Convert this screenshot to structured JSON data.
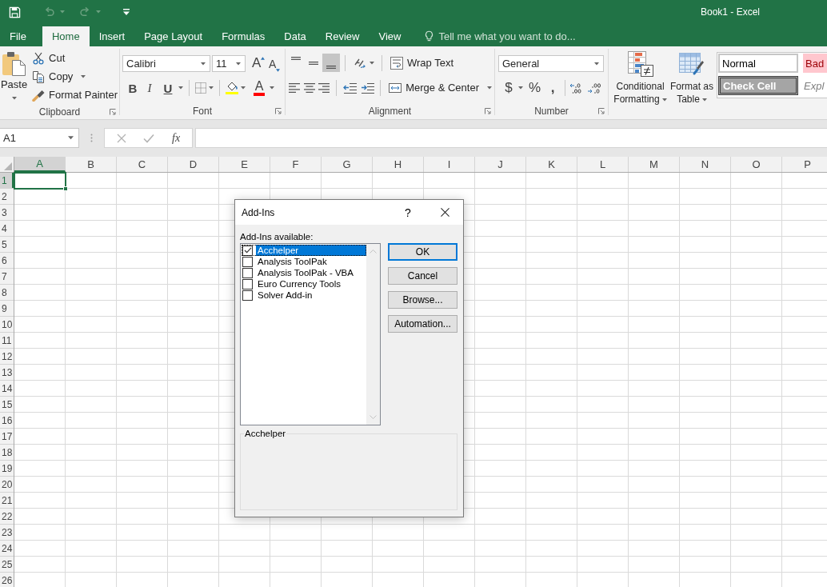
{
  "window": {
    "title": "Book1 - Excel"
  },
  "quick_access": [
    {
      "kind": "save",
      "disabled": false
    },
    {
      "kind": "undo",
      "disabled": true
    },
    {
      "kind": "redo",
      "disabled": true
    },
    {
      "kind": "customize",
      "disabled": false
    }
  ],
  "tabs": [
    {
      "label": "File",
      "selected": false
    },
    {
      "label": "Home",
      "selected": true
    },
    {
      "label": "Insert",
      "selected": false
    },
    {
      "label": "Page Layout",
      "selected": false
    },
    {
      "label": "Formulas",
      "selected": false
    },
    {
      "label": "Data",
      "selected": false
    },
    {
      "label": "Review",
      "selected": false
    },
    {
      "label": "View",
      "selected": false
    }
  ],
  "tell_me": {
    "placeholder": "Tell me what you want to do..."
  },
  "ribbon": {
    "clipboard": {
      "label": "Clipboard",
      "paste": "Paste",
      "cut": "Cut",
      "copy": "Copy",
      "format_painter": "Format Painter"
    },
    "font": {
      "label": "Font",
      "font_name": "Calibri",
      "font_size": "11",
      "grow_font": "A",
      "shrink_font": "A",
      "bold": "B",
      "italic": "I",
      "underline": "U",
      "font_color": "A"
    },
    "alignment": {
      "label": "Alignment",
      "vertical_align": [
        {
          "kind": "top",
          "on": false
        },
        {
          "kind": "middle",
          "on": false
        },
        {
          "kind": "bottom",
          "on": true
        }
      ],
      "horizontal_align": [
        {
          "kind": "left",
          "on": false
        },
        {
          "kind": "center",
          "on": false
        },
        {
          "kind": "right",
          "on": false
        }
      ],
      "wrap_text": "Wrap Text",
      "merge_center": "Merge & Center"
    },
    "number": {
      "label": "Number",
      "format": "General",
      "accounting": "$",
      "percent": "%",
      "comma": ","
    },
    "styles": {
      "conditional_formatting": "Conditional Formatting",
      "format_as_table": "Format as Table",
      "cell_styles": [
        {
          "label": "Normal",
          "kind": "normal"
        },
        {
          "label": "Bad",
          "kind": "bad"
        },
        {
          "label": "Check Cell",
          "kind": "check"
        },
        {
          "label": "Expl",
          "kind": "explanatory"
        }
      ]
    }
  },
  "formula_bar": {
    "name_box": "A1",
    "insert_function": "fx"
  },
  "sheet": {
    "columns": [
      {
        "label": "A",
        "selected": true
      },
      {
        "label": "B",
        "selected": false
      },
      {
        "label": "C",
        "selected": false
      },
      {
        "label": "D",
        "selected": false
      },
      {
        "label": "E",
        "selected": false
      },
      {
        "label": "F",
        "selected": false
      },
      {
        "label": "G",
        "selected": false
      },
      {
        "label": "H",
        "selected": false
      },
      {
        "label": "I",
        "selected": false
      },
      {
        "label": "J",
        "selected": false
      },
      {
        "label": "K",
        "selected": false
      },
      {
        "label": "L",
        "selected": false
      },
      {
        "label": "M",
        "selected": false
      },
      {
        "label": "N",
        "selected": false
      },
      {
        "label": "O",
        "selected": false
      },
      {
        "label": "P",
        "selected": false
      }
    ],
    "rows": [
      {
        "label": "1",
        "selected": true
      },
      {
        "label": "2",
        "selected": false
      },
      {
        "label": "3",
        "selected": false
      },
      {
        "label": "4",
        "selected": false
      },
      {
        "label": "5",
        "selected": false
      },
      {
        "label": "6",
        "selected": false
      },
      {
        "label": "7",
        "selected": false
      },
      {
        "label": "8",
        "selected": false
      },
      {
        "label": "9",
        "selected": false
      },
      {
        "label": "10",
        "selected": false
      },
      {
        "label": "11",
        "selected": false
      },
      {
        "label": "12",
        "selected": false
      },
      {
        "label": "13",
        "selected": false
      },
      {
        "label": "14",
        "selected": false
      },
      {
        "label": "15",
        "selected": false
      },
      {
        "label": "16",
        "selected": false
      },
      {
        "label": "17",
        "selected": false
      },
      {
        "label": "18",
        "selected": false
      },
      {
        "label": "19",
        "selected": false
      },
      {
        "label": "20",
        "selected": false
      },
      {
        "label": "21",
        "selected": false
      },
      {
        "label": "22",
        "selected": false
      },
      {
        "label": "23",
        "selected": false
      },
      {
        "label": "24",
        "selected": false
      },
      {
        "label": "25",
        "selected": false
      },
      {
        "label": "26",
        "selected": false
      }
    ]
  },
  "dialog": {
    "title": "Add-Ins",
    "help": "?",
    "list_label": "Add-Ins available:",
    "items": [
      {
        "label": "Acchelper",
        "checked": true,
        "selected": true
      },
      {
        "label": "Analysis ToolPak",
        "checked": false,
        "selected": false
      },
      {
        "label": "Analysis ToolPak - VBA",
        "checked": false,
        "selected": false
      },
      {
        "label": "Euro Currency Tools",
        "checked": false,
        "selected": false
      },
      {
        "label": "Solver Add-in",
        "checked": false,
        "selected": false
      }
    ],
    "buttons": [
      {
        "label": "OK",
        "default": true
      },
      {
        "label": "Cancel",
        "default": false
      },
      {
        "label": "Browse...",
        "default": false
      },
      {
        "label": "Automation...",
        "default": false
      }
    ],
    "description_title": "Acchelper"
  }
}
